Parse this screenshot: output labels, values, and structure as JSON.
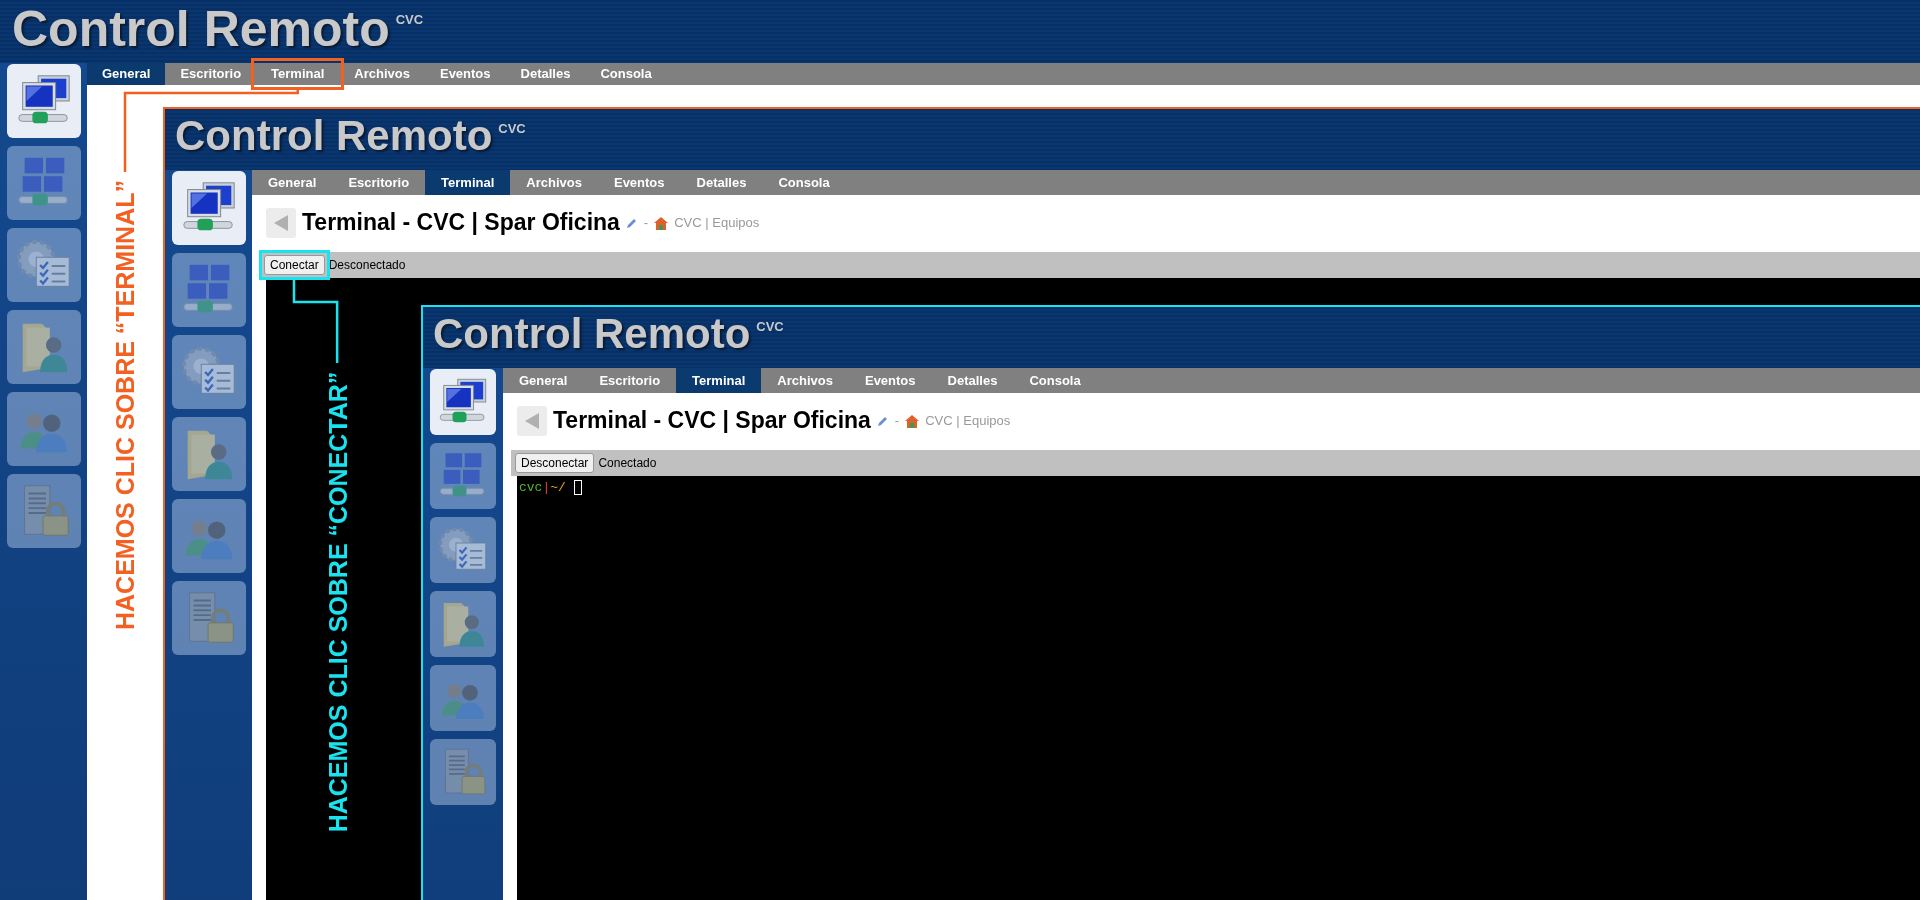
{
  "levels": [
    {
      "title": "Control Remoto",
      "superscript": "CVC",
      "tabs": [
        {
          "label": "General",
          "selected": true
        },
        {
          "label": "Escritorio",
          "selected": false
        },
        {
          "label": "Terminal",
          "selected": false
        },
        {
          "label": "Archivos",
          "selected": false
        },
        {
          "label": "Eventos",
          "selected": false
        },
        {
          "label": "Detalles",
          "selected": false
        },
        {
          "label": "Consola",
          "selected": false
        }
      ],
      "sidebar": {
        "items": [
          {
            "kind": "network",
            "selected": true
          },
          {
            "kind": "desktop",
            "selected": false
          },
          {
            "kind": "tasks",
            "selected": false
          },
          {
            "kind": "files",
            "selected": false
          },
          {
            "kind": "users",
            "selected": false
          },
          {
            "kind": "security",
            "selected": false
          }
        ]
      }
    },
    {
      "color": "#f26122",
      "title": "Control Remoto",
      "superscript": "CVC",
      "tabs": [
        {
          "label": "General",
          "selected": false
        },
        {
          "label": "Escritorio",
          "selected": false
        },
        {
          "label": "Terminal",
          "selected": true
        },
        {
          "label": "Archivos",
          "selected": false
        },
        {
          "label": "Eventos",
          "selected": false
        },
        {
          "label": "Detalles",
          "selected": false
        },
        {
          "label": "Consola",
          "selected": false
        }
      ],
      "sidebar": {
        "items": [
          {
            "kind": "network",
            "selected": true
          },
          {
            "kind": "desktop",
            "selected": false
          },
          {
            "kind": "tasks",
            "selected": false
          },
          {
            "kind": "files",
            "selected": false
          },
          {
            "kind": "users",
            "selected": false
          },
          {
            "kind": "security",
            "selected": false
          }
        ]
      },
      "page": {
        "title": "Terminal - CVC | Spar Oficina",
        "separator": "-",
        "breadcrumb": "CVC | Equipos",
        "button": "Conectar",
        "status": "Desconectado"
      }
    },
    {
      "color": "#19e3ee",
      "title": "Control Remoto",
      "superscript": "CVC",
      "tabs": [
        {
          "label": "General",
          "selected": false
        },
        {
          "label": "Escritorio",
          "selected": false
        },
        {
          "label": "Terminal",
          "selected": true
        },
        {
          "label": "Archivos",
          "selected": false
        },
        {
          "label": "Eventos",
          "selected": false
        },
        {
          "label": "Detalles",
          "selected": false
        },
        {
          "label": "Consola",
          "selected": false
        }
      ],
      "sidebar": {
        "items": [
          {
            "kind": "network",
            "selected": true
          },
          {
            "kind": "desktop",
            "selected": false
          },
          {
            "kind": "tasks",
            "selected": false
          },
          {
            "kind": "files",
            "selected": false
          },
          {
            "kind": "users",
            "selected": false
          },
          {
            "kind": "security",
            "selected": false
          }
        ]
      },
      "page": {
        "title": "Terminal - CVC | Spar Oficina",
        "separator": "-",
        "breadcrumb": "CVC | Equipos",
        "button": "Desconectar",
        "status": "Conectado",
        "prompt": [
          {
            "kind": "user",
            "text": "cvc"
          },
          {
            "kind": "separator",
            "text": "|"
          },
          {
            "kind": "path",
            "text": "~/"
          }
        ]
      }
    }
  ],
  "annotations": [
    {
      "text": "HACEMOS CLIC SOBRE “TERMINAL”",
      "color": "#f26122"
    },
    {
      "text": "HACEMOS CLIC SOBRE “CONECTAR”",
      "color": "#19e3ee"
    }
  ]
}
